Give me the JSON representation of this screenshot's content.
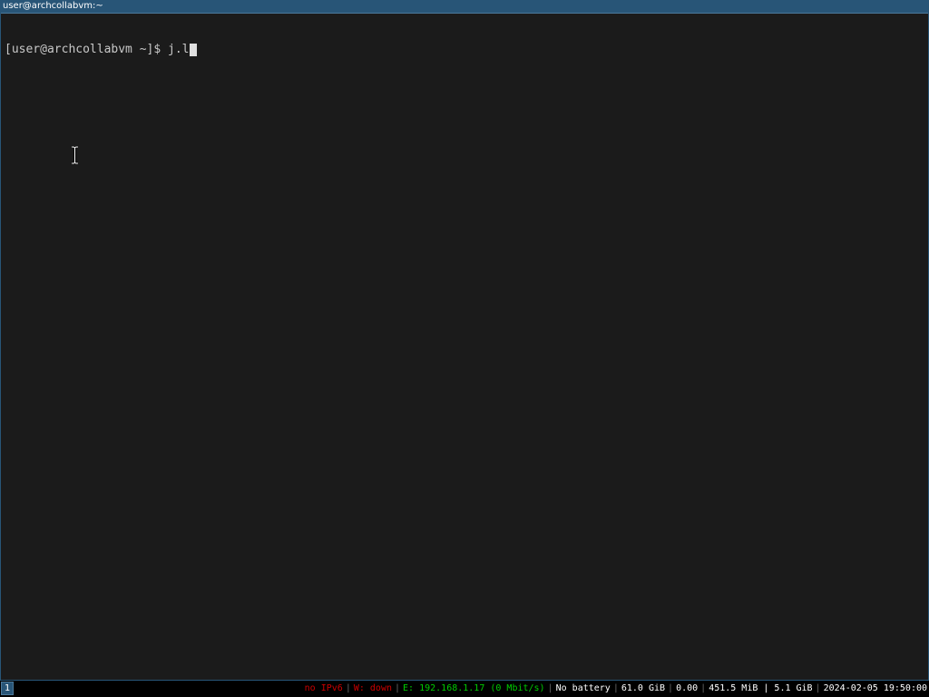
{
  "window": {
    "title": "user@archcollabvm:~"
  },
  "terminal": {
    "prompt": "[user@archcollabvm ~]$ ",
    "command": "j.l"
  },
  "status_bar": {
    "workspace": "1",
    "items": [
      {
        "id": "ipv6",
        "text": "no IPv6",
        "color": "#cc0000"
      },
      {
        "id": "wifi",
        "text": "W: down",
        "color": "#cc0000"
      },
      {
        "id": "ethernet",
        "text": "E: 192.168.1.17 (0 Mbit/s)",
        "color": "#00cc00"
      },
      {
        "id": "battery",
        "text": "No battery",
        "color": "#ffffff"
      },
      {
        "id": "disk",
        "text": "61.0 GiB",
        "color": "#ffffff"
      },
      {
        "id": "load",
        "text": "0.00",
        "color": "#ffffff"
      },
      {
        "id": "memory",
        "text": "451.5 MiB | 5.1 GiB",
        "color": "#ffffff"
      },
      {
        "id": "datetime",
        "text": "2024-02-05 19:50:00",
        "color": "#ffffff"
      }
    ]
  },
  "colors": {
    "focused_border": "#285577",
    "terminal_bg": "#1b1b1b",
    "terminal_fg": "#c8c8c8"
  }
}
